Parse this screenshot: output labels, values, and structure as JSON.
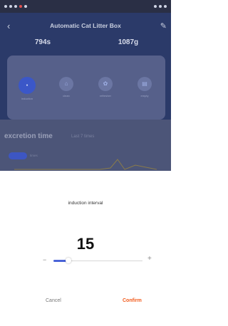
{
  "app": {
    "title": "Automatic Cat Litter Box",
    "stat_time": "794s",
    "stat_weight": "1087g",
    "functions": [
      {
        "label": "induction",
        "icon": "sensor-icon"
      },
      {
        "label": "clean",
        "icon": "broom-icon"
      },
      {
        "label": "refresher",
        "icon": "fan-icon"
      },
      {
        "label": "empty",
        "icon": "trash-icon"
      }
    ],
    "section_title": "excretion time",
    "section_sub": "Last 7 times",
    "toggle_label": "times"
  },
  "dialog": {
    "title": "induction interval",
    "value": "15",
    "slider_fraction": 0.17,
    "minus": "−",
    "plus": "+",
    "cancel": "Cancel",
    "confirm": "Confirm"
  },
  "colors": {
    "accent": "#4a64d8",
    "confirm": "#f25b1c",
    "app_bg": "#2b3a69"
  }
}
